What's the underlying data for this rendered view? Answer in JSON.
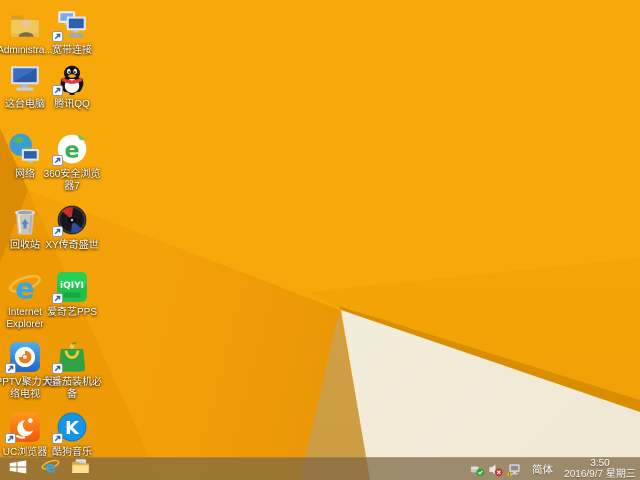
{
  "colors": {
    "base": "#F7A80B",
    "wedge": "#DB8C04",
    "band": "#EE9A05",
    "mid1": "#F3A209",
    "mid2": "#DF8C04",
    "gold1": "#F8AB08",
    "gold2": "#EFA006",
    "edge": "#D88E00",
    "tan1": "#D9A74E",
    "tan2": "#CC9C43",
    "white1": "#F8F3E4",
    "white2": "#EFE8D4",
    "taskbar": "rgba(124,102,66,0.72)"
  },
  "desktop": {
    "icons": [
      {
        "id": "administrator-folder",
        "label_lines": [
          "Administra..."
        ],
        "col": 0,
        "row": 0,
        "shortcut_arrow": false,
        "glyph": "user-folder-icon"
      },
      {
        "id": "broadband-connection",
        "label_lines": [
          "宽带连接"
        ],
        "col": 1,
        "row": 0,
        "shortcut_arrow": true,
        "glyph": "dual-monitor-icon"
      },
      {
        "id": "this-pc",
        "label_lines": [
          "这台电脑"
        ],
        "col": 0,
        "row": 1,
        "shortcut_arrow": false,
        "glyph": "computer-icon"
      },
      {
        "id": "tencent-qq",
        "label_lines": [
          "腾讯QQ"
        ],
        "col": 1,
        "row": 1,
        "shortcut_arrow": true,
        "glyph": "qq-penguin-icon"
      },
      {
        "id": "network",
        "label_lines": [
          "网络"
        ],
        "col": 0,
        "row": 2,
        "shortcut_arrow": false,
        "glyph": "globe-monitor-icon"
      },
      {
        "id": "360-browser",
        "label_lines": [
          "360安全浏览",
          "器7"
        ],
        "col": 1,
        "row": 2,
        "shortcut_arrow": true,
        "glyph": "green-e-icon"
      },
      {
        "id": "recycle-bin",
        "label_lines": [
          "回收站"
        ],
        "col": 0,
        "row": 3,
        "shortcut_arrow": false,
        "glyph": "recycle-bin-icon"
      },
      {
        "id": "xy-legend-game",
        "label_lines": [
          "XY传奇盛世"
        ],
        "col": 1,
        "row": 3,
        "shortcut_arrow": true,
        "glyph": "dark-game-disc-icon"
      },
      {
        "id": "internet-explorer",
        "label_lines": [
          "Internet",
          "Explorer"
        ],
        "col": 0,
        "row": 4,
        "shortcut_arrow": false,
        "glyph": "blue-e-icon"
      },
      {
        "id": "iqiyi-pps",
        "label_lines": [
          "爱奇艺PPS"
        ],
        "col": 1,
        "row": 4,
        "shortcut_arrow": true,
        "glyph": "iqiyi-icon"
      },
      {
        "id": "pptv",
        "label_lines": [
          "PPTV聚力 网",
          "络电视"
        ],
        "col": 0,
        "row": 5,
        "shortcut_arrow": true,
        "glyph": "pptv-swirl-icon"
      },
      {
        "id": "big-tomato",
        "label_lines": [
          "大番茄装机必",
          "备"
        ],
        "col": 1,
        "row": 5,
        "shortcut_arrow": true,
        "glyph": "green-bag-icon"
      },
      {
        "id": "uc-browser",
        "label_lines": [
          "UC浏览器"
        ],
        "col": 0,
        "row": 6,
        "shortcut_arrow": true,
        "glyph": "uc-squirrel-icon"
      },
      {
        "id": "kugou-music",
        "label_lines": [
          "酷狗音乐"
        ],
        "col": 1,
        "row": 6,
        "shortcut_arrow": true,
        "glyph": "kugou-k-icon"
      }
    ]
  },
  "taskbar": {
    "buttons": [
      {
        "id": "start",
        "glyph": "windows-logo-icon"
      },
      {
        "id": "internet-explorer",
        "glyph": "blue-e-icon"
      },
      {
        "id": "file-explorer",
        "glyph": "folder-icon"
      }
    ],
    "tray": {
      "icons": [
        "usb-safely-remove-icon",
        "volume-muted-icon",
        "network-warning-icon"
      ],
      "language": "简体",
      "clock": {
        "time": "3:50",
        "date": "2016/9/7",
        "weekday": "星期三"
      }
    }
  }
}
